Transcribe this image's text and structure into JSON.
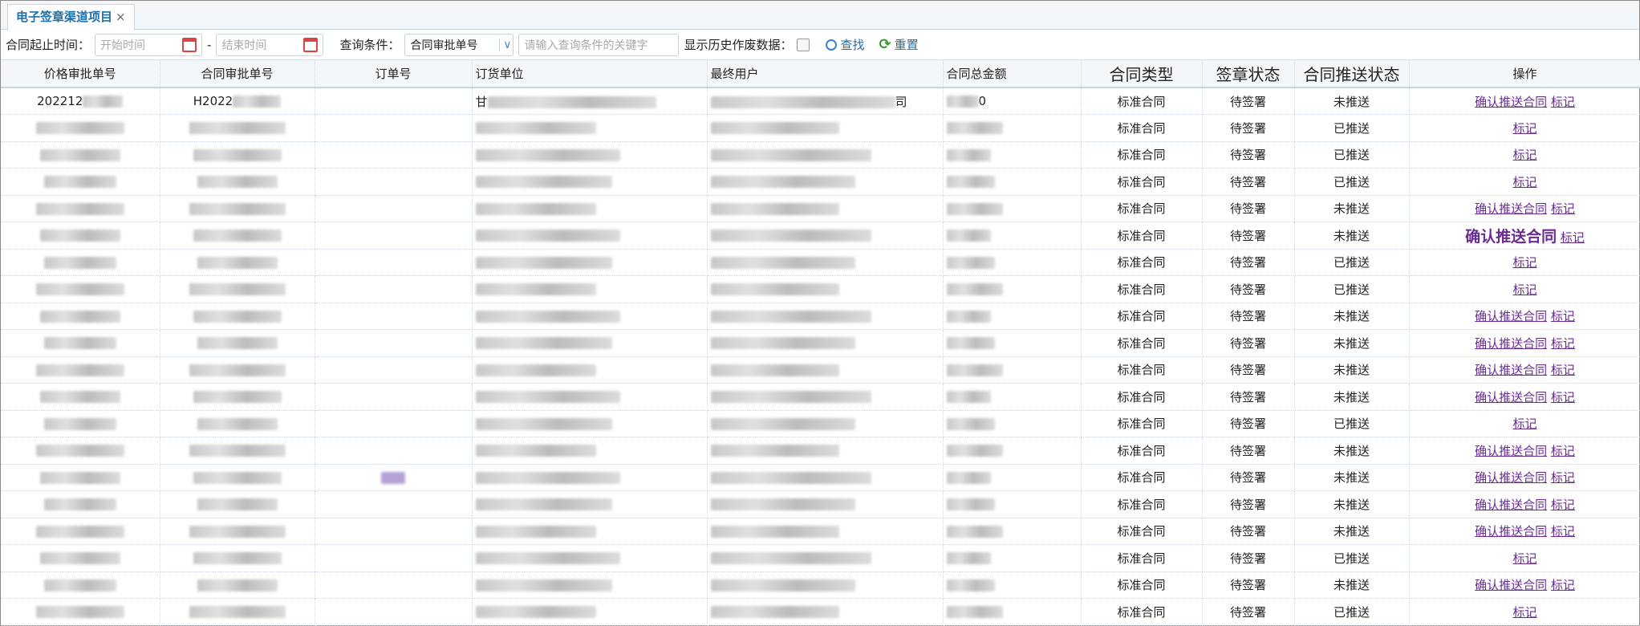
{
  "tab": {
    "label": "电子签章渠道项目",
    "close": "×"
  },
  "toolbar": {
    "date_label": "合同起止时间：",
    "start_placeholder": "开始时间",
    "dash": "-",
    "end_placeholder": "结束时间",
    "cond_label": "查询条件：",
    "cond_value": "合同审批单号",
    "chev": "∨",
    "keyword_placeholder": "请输入查询条件的关键字",
    "history_label": "显示历史作废数据：",
    "search": "查找",
    "reset": "重置"
  },
  "columns": [
    "价格审批单号",
    "合同审批单号",
    "订单号",
    "订货单位",
    "最终用户",
    "合同总金额",
    "合同类型",
    "签章状态",
    "合同推送状态",
    "操作"
  ],
  "row1_fragments": {
    "price_no": "202212",
    "contract_no": "H2022",
    "unit": "甘",
    "user_end": "司",
    "amount_end": "0"
  },
  "action_labels": {
    "confirm": "确认推送合同",
    "mark": "标记"
  },
  "rows": [
    {
      "type": "标准合同",
      "sign": "待签署",
      "push": "未推送"
    },
    {
      "type": "标准合同",
      "sign": "待签署",
      "push": "已推送"
    },
    {
      "type": "标准合同",
      "sign": "待签署",
      "push": "已推送"
    },
    {
      "type": "标准合同",
      "sign": "待签署",
      "push": "已推送"
    },
    {
      "type": "标准合同",
      "sign": "待签署",
      "push": "未推送"
    },
    {
      "type": "标准合同",
      "sign": "待签署",
      "push": "未推送"
    },
    {
      "type": "标准合同",
      "sign": "待签署",
      "push": "已推送"
    },
    {
      "type": "标准合同",
      "sign": "待签署",
      "push": "已推送"
    },
    {
      "type": "标准合同",
      "sign": "待签署",
      "push": "未推送"
    },
    {
      "type": "标准合同",
      "sign": "待签署",
      "push": "未推送"
    },
    {
      "type": "标准合同",
      "sign": "待签署",
      "push": "未推送"
    },
    {
      "type": "标准合同",
      "sign": "待签署",
      "push": "未推送"
    },
    {
      "type": "标准合同",
      "sign": "待签署",
      "push": "已推送"
    },
    {
      "type": "标准合同",
      "sign": "待签署",
      "push": "未推送"
    },
    {
      "type": "标准合同",
      "sign": "待签署",
      "push": "未推送"
    },
    {
      "type": "标准合同",
      "sign": "待签署",
      "push": "未推送"
    },
    {
      "type": "标准合同",
      "sign": "待签署",
      "push": "未推送"
    },
    {
      "type": "标准合同",
      "sign": "待签署",
      "push": "已推送"
    },
    {
      "type": "标准合同",
      "sign": "待签署",
      "push": "未推送"
    },
    {
      "type": "标准合同",
      "sign": "待签署",
      "push": "已推送"
    }
  ]
}
